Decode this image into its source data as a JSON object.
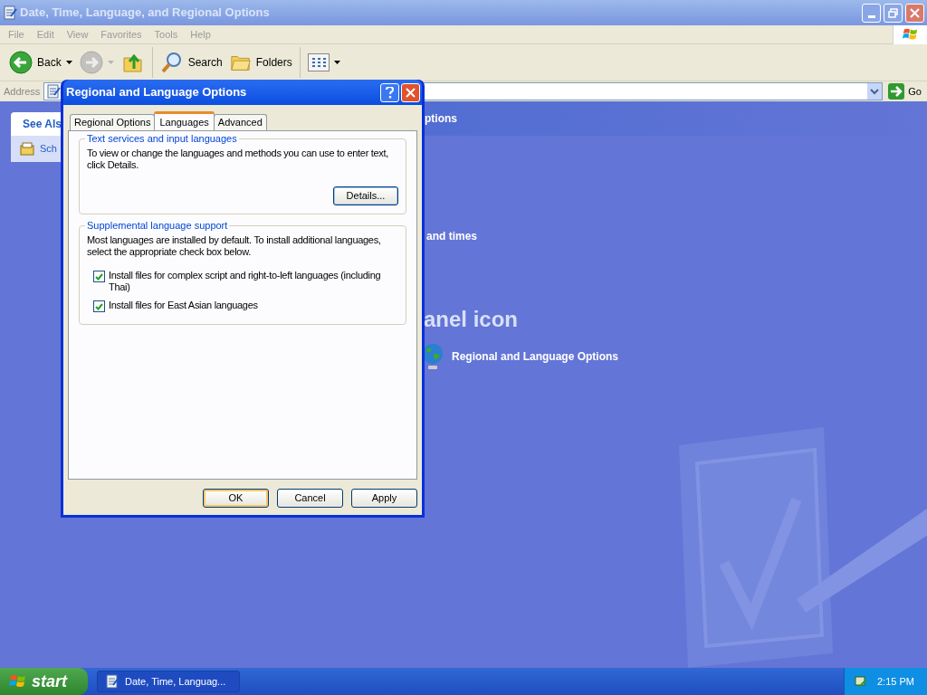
{
  "window": {
    "title": "Date, Time, Language, and Regional Options"
  },
  "menu": [
    "File",
    "Edit",
    "View",
    "Favorites",
    "Tools",
    "Help"
  ],
  "toolbar": [
    {
      "kind": "back",
      "label": "Back"
    },
    {
      "kind": "forward"
    },
    {
      "kind": "up"
    },
    {
      "kind": "search",
      "label": "Search"
    },
    {
      "kind": "folders",
      "label": "Folders"
    },
    {
      "kind": "views"
    }
  ],
  "address": {
    "label": "Address",
    "go": "Go"
  },
  "sidebar": {
    "title": "See Als",
    "items": [
      "Sch"
    ]
  },
  "content": {
    "header": "ptions",
    "section_title": "and times",
    "subheading": "anel icon",
    "link": "Regional and Language Options"
  },
  "dialog": {
    "title": "Regional and Language Options",
    "tabs": [
      {
        "label": "Regional Options",
        "selected": false
      },
      {
        "label": "Languages",
        "selected": true
      },
      {
        "label": "Advanced",
        "selected": false
      }
    ],
    "groups": [
      {
        "title": "Text services and input languages",
        "text": "To view or change the languages and methods you can use to enter text, click Details.",
        "button": "Details..."
      },
      {
        "title": "Supplemental language support",
        "text": "Most languages are installed by default. To install additional languages, select the appropriate check box below.",
        "checkboxes": [
          {
            "label": "Install files for complex script and right-to-left languages (including Thai)",
            "checked": true
          },
          {
            "label": "Install files for East Asian languages",
            "checked": true
          }
        ]
      }
    ],
    "buttons": [
      {
        "label": "OK",
        "default": true
      },
      {
        "label": "Cancel",
        "default": false
      },
      {
        "label": "Apply",
        "default": false
      }
    ]
  },
  "taskbar": {
    "start": "start",
    "tasks": [
      {
        "label": "Date, Time, Languag..."
      }
    ],
    "clock": "2:15 PM"
  }
}
